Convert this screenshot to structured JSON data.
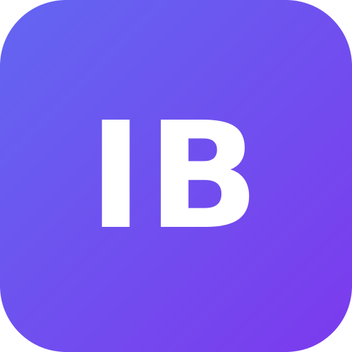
{
  "app_icon": {
    "monogram": "IB",
    "colors": {
      "gradient_start": "#6366f1",
      "gradient_end": "#7c3aed",
      "text": "#ffffff"
    }
  }
}
